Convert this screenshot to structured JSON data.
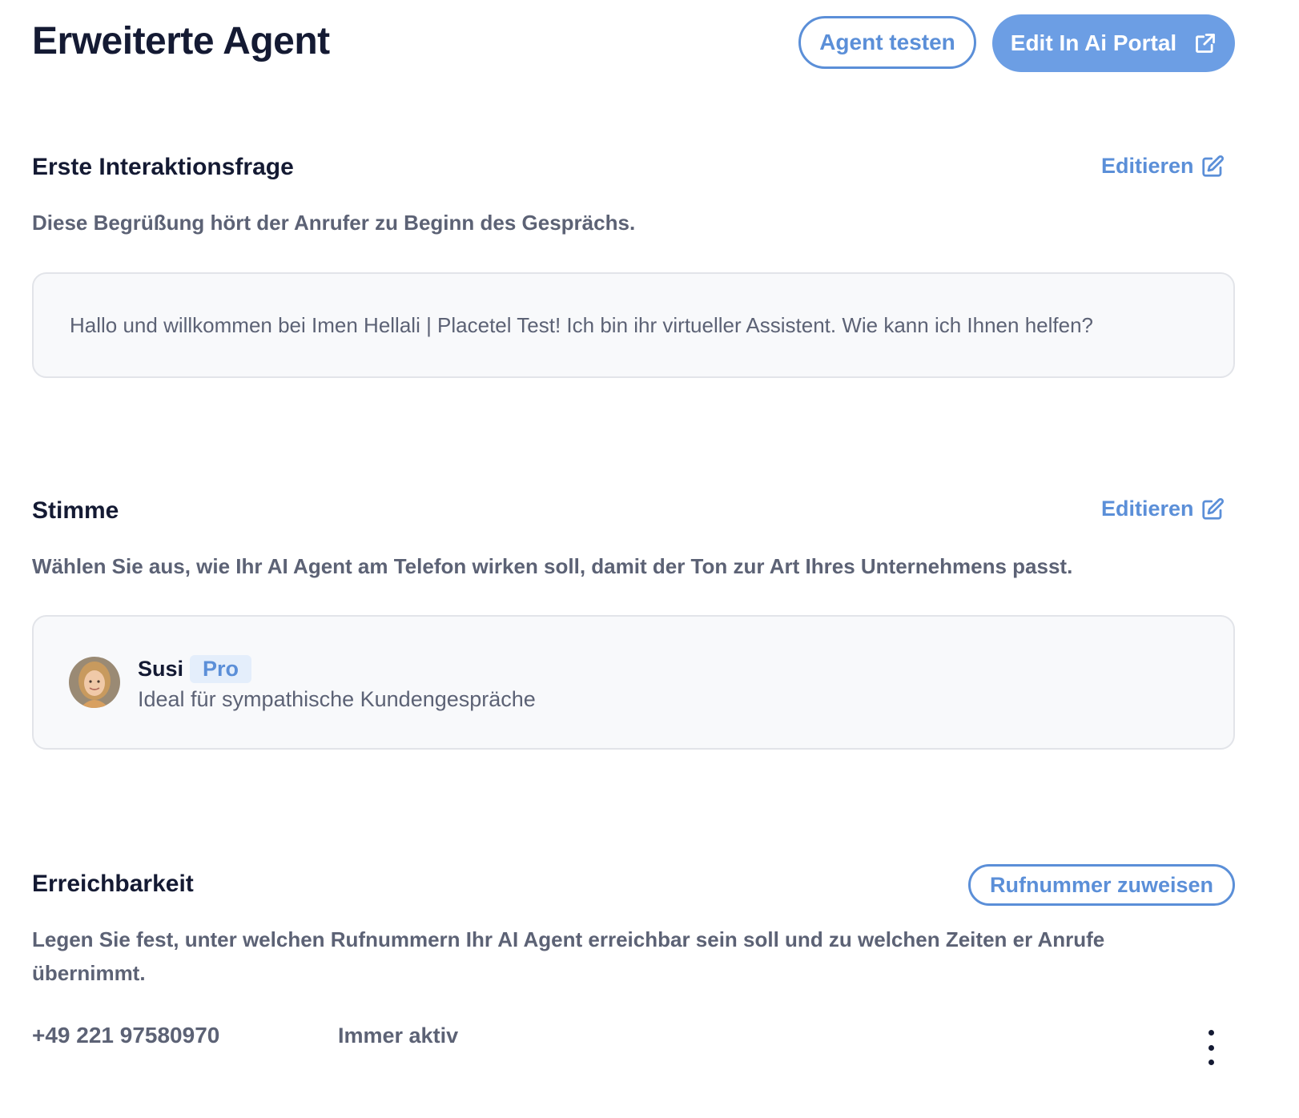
{
  "header": {
    "title": "Erweiterte Agent",
    "test_button": "Agent testen",
    "portal_button": "Edit In Ai Portal",
    "portal_icon": "external-link-icon"
  },
  "greeting_section": {
    "title": "Erste Interaktionsfrage",
    "edit_label": "Editieren",
    "edit_icon": "edit-icon",
    "description": "Diese Begrüßung hört der Anrufer zu Beginn des Gesprächs.",
    "greeting_text": "Hallo und willkommen bei Imen Hellali | Placetel Test! Ich bin ihr virtueller Assistent. Wie kann ich Ihnen helfen?"
  },
  "voice_section": {
    "title": "Stimme",
    "edit_label": "Editieren",
    "edit_icon": "edit-icon",
    "description": "Wählen Sie aus, wie Ihr AI Agent am Telefon wirken soll, damit der Ton zur Art Ihres Unternehmens passt.",
    "voice": {
      "name": "Susi",
      "badge": "Pro",
      "description": "Ideal für sympathische Kundengespräche"
    }
  },
  "reachability_section": {
    "title": "Erreichbarkeit",
    "assign_button": "Rufnummer zuweisen",
    "description": "Legen Sie fest, unter welchen Rufnummern Ihr AI Agent erreichbar sein soll und zu welchen Zeiten er Anrufe übernimmt.",
    "numbers": [
      {
        "number": "+49 221 97580970",
        "status": "Immer aktiv"
      }
    ]
  },
  "colors": {
    "accent": "#5b8fd8",
    "primary_button": "#6c9ee4",
    "heading": "#141a33",
    "muted_text": "#5c6275",
    "card_bg": "#f8f9fb",
    "card_border": "#e2e4e9"
  }
}
